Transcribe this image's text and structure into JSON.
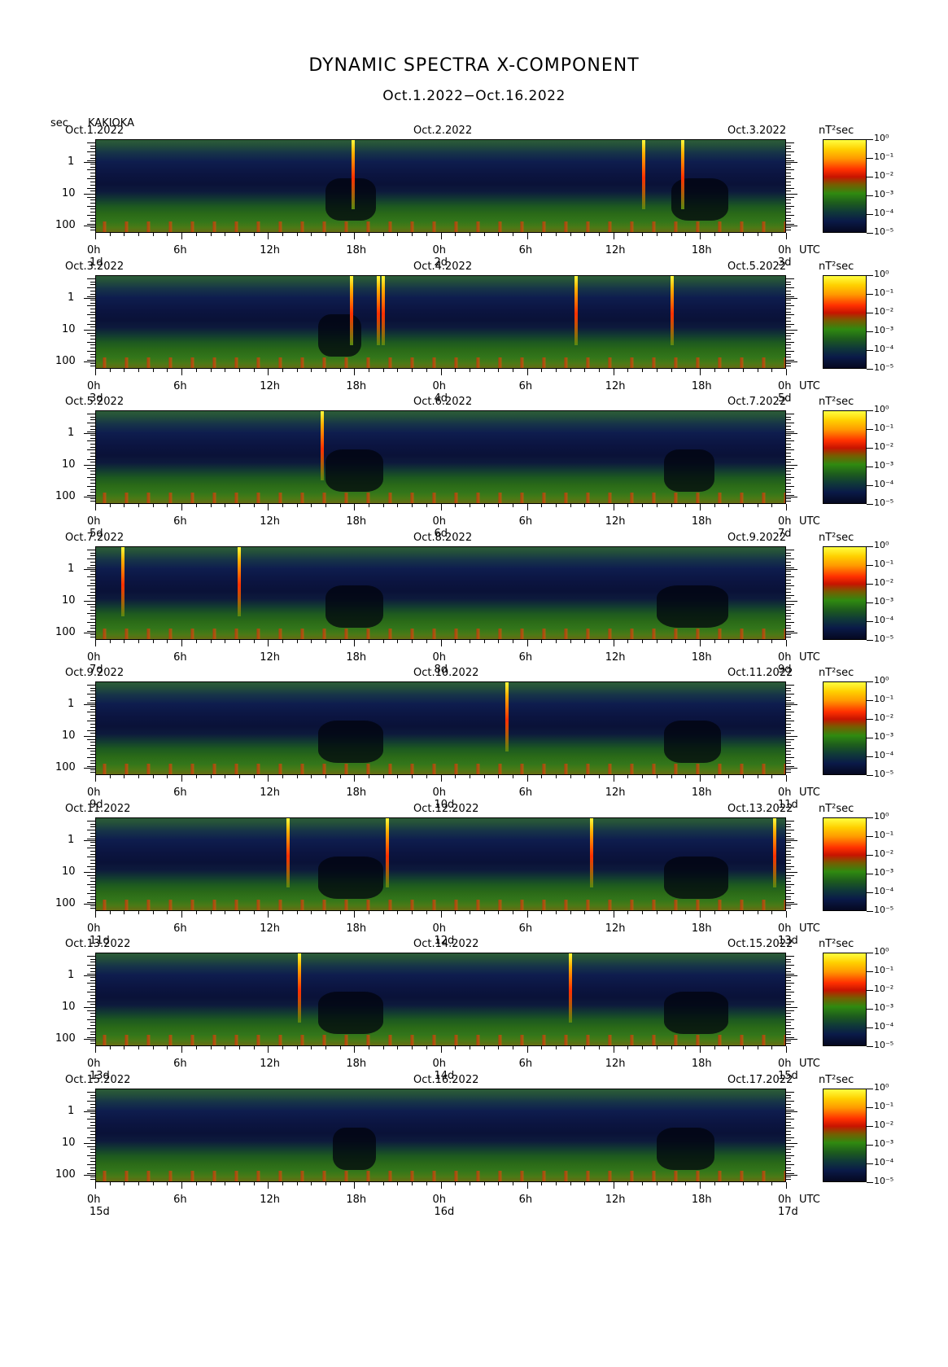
{
  "chart_data": {
    "type": "heatmap",
    "title": "DYNAMIC SPECTRA X-COMPONENT",
    "subtitle": "Oct.1.2022−Oct.16.2022",
    "y_unit": "sec",
    "station": "KAKIOKA",
    "color_unit": "nT²sec",
    "colorbar_ticks": [
      "10⁰",
      "10⁻¹",
      "10⁻²",
      "10⁻³",
      "10⁻⁴",
      "10⁻⁵"
    ],
    "y_ticks": [
      "1",
      "10",
      "100"
    ],
    "y_log_scale": true,
    "x_ticks": [
      "0h",
      "6h",
      "12h",
      "18h",
      "0h",
      "6h",
      "12h",
      "18h",
      "0h"
    ],
    "x_unit_label": "UTC",
    "panels": [
      {
        "date_left": "Oct.1.2022",
        "date_mid": "Oct.2.2022",
        "date_right": "Oct.3.2022",
        "day_left": "1d",
        "day_mid": "2d",
        "day_right": "3d",
        "spikes_hours": [
          17.9,
          38.1,
          40.8
        ],
        "dark_regions_hours": [
          [
            16.0,
            19.5
          ],
          [
            40.0,
            44.0
          ]
        ]
      },
      {
        "date_left": "Oct.3.2022",
        "date_mid": "Oct.4.2022",
        "date_right": "Oct.5.2022",
        "day_left": "3d",
        "day_mid": "4d",
        "day_right": "5d",
        "spikes_hours": [
          17.8,
          19.7,
          20.0,
          33.4,
          40.1
        ],
        "dark_regions_hours": [
          [
            15.5,
            18.5
          ]
        ]
      },
      {
        "date_left": "Oct.5.2022",
        "date_mid": "Oct.6.2022",
        "date_right": "Oct.7.2022",
        "day_left": "5d",
        "day_mid": "6d",
        "day_right": "7d",
        "spikes_hours": [
          15.8
        ],
        "dark_regions_hours": [
          [
            16.0,
            20.0
          ],
          [
            39.5,
            43.0
          ]
        ]
      },
      {
        "date_left": "Oct.7.2022",
        "date_mid": "Oct.8.2022",
        "date_right": "Oct.9.2022",
        "day_left": "7d",
        "day_mid": "8d",
        "day_right": "9d",
        "spikes_hours": [
          1.9,
          10.0
        ],
        "dark_regions_hours": [
          [
            16.0,
            20.0
          ],
          [
            39.0,
            44.0
          ]
        ]
      },
      {
        "date_left": "Oct.9.2022",
        "date_mid": "Oct.10.2022",
        "date_right": "Oct.11.2022",
        "day_left": "9d",
        "day_mid": "10d",
        "day_right": "11d",
        "spikes_hours": [
          28.6
        ],
        "dark_regions_hours": [
          [
            15.5,
            20.0
          ],
          [
            39.5,
            43.5
          ]
        ]
      },
      {
        "date_left": "Oct.11.2022",
        "date_mid": "Oct.12.2022",
        "date_right": "Oct.13.2022",
        "day_left": "11d",
        "day_mid": "12d",
        "day_right": "13d",
        "spikes_hours": [
          13.4,
          20.3,
          34.5,
          47.2
        ],
        "dark_regions_hours": [
          [
            15.5,
            20.0
          ],
          [
            39.5,
            44.0
          ]
        ]
      },
      {
        "date_left": "Oct.13.2022",
        "date_mid": "Oct.14.2022",
        "date_right": "Oct.15.2022",
        "day_left": "13d",
        "day_mid": "14d",
        "day_right": "15d",
        "spikes_hours": [
          14.2,
          33.0
        ],
        "dark_regions_hours": [
          [
            15.5,
            20.0
          ],
          [
            39.5,
            44.0
          ]
        ]
      },
      {
        "date_left": "Oct.15.2022",
        "date_mid": "Oct.16.2022",
        "date_right": "Oct.17.2022",
        "day_left": "15d",
        "day_mid": "16d",
        "day_right": "17d",
        "spikes_hours": [],
        "dark_regions_hours": [
          [
            16.5,
            19.5
          ],
          [
            39.0,
            43.0
          ]
        ]
      }
    ]
  }
}
